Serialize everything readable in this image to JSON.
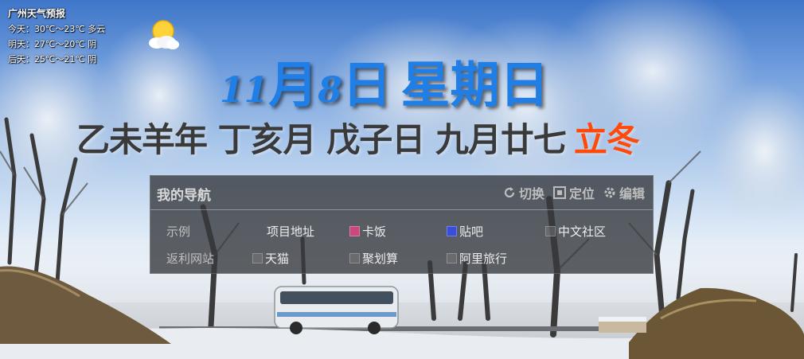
{
  "weather": {
    "city": "广州天气预报",
    "today": "今天：30℃～23℃ 多云",
    "tomorrow": "明天：27℃～20℃ 阴",
    "day_after": "后天：25℃～21℃ 阴",
    "icon": "sun-cloud-icon"
  },
  "date": {
    "month_num": "11",
    "month_char": "月",
    "day_num": "8",
    "day_char": "日",
    "weekday": "星期日"
  },
  "lunar": {
    "text": "乙未羊年 丁亥月 戊子日 九月廿七",
    "solar_term": "立冬"
  },
  "nav": {
    "title": "我的导航",
    "tools": [
      {
        "label": "切换",
        "icon": "refresh-icon"
      },
      {
        "label": "定位",
        "icon": "locate-icon"
      },
      {
        "label": "编辑",
        "icon": "gear-icon"
      }
    ],
    "rows": [
      {
        "label": "示例",
        "links": [
          "项目地址",
          "卡饭",
          "贴吧",
          "中文社区"
        ]
      },
      {
        "label": "返利网站",
        "links": [
          "天猫",
          "聚划算",
          "阿里旅行"
        ]
      }
    ]
  },
  "colors": {
    "date_blue": "#1f7fe6",
    "solar_term_orange": "#ff4a0c",
    "panel_bg": "rgba(55,58,62,0.80)"
  }
}
